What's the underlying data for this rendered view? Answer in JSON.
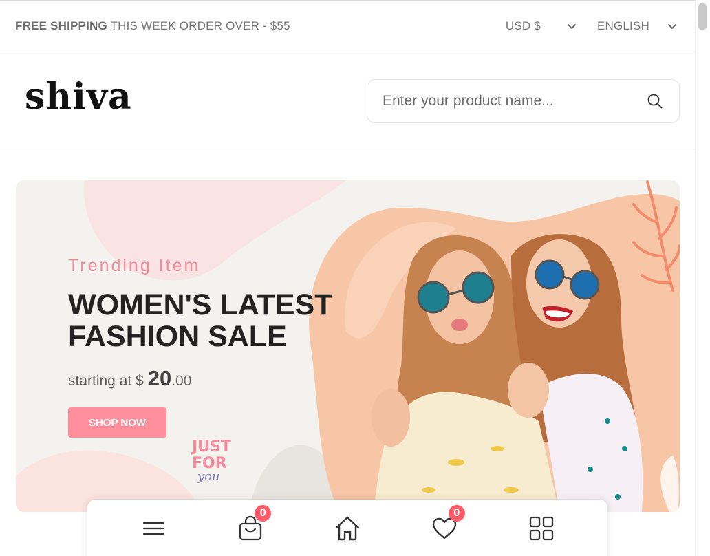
{
  "topbar": {
    "shipping_bold": "FREE SHIPPING",
    "shipping_rest": " THIS WEEK ORDER OVER - $55",
    "currency": "USD $",
    "language": "ENGLISH"
  },
  "header": {
    "logo": "shiva",
    "search_placeholder": "Enter your product name..."
  },
  "banner": {
    "subtitle": "Trending Item",
    "title": "WOMEN'S LATEST FASHION SALE",
    "price_prefix": "starting at $",
    "price_whole": "20",
    "price_cents": ".00",
    "button": "SHOP NOW",
    "sticker_lines": [
      "JUST",
      "FOR",
      "you"
    ]
  },
  "bottom_nav": {
    "cart_count": "0",
    "wishlist_count": "0"
  },
  "colors": {
    "accent_pink": "#ff8f9c",
    "badge_red": "#ff5b69",
    "subtitle_pink": "#f48a9a"
  }
}
